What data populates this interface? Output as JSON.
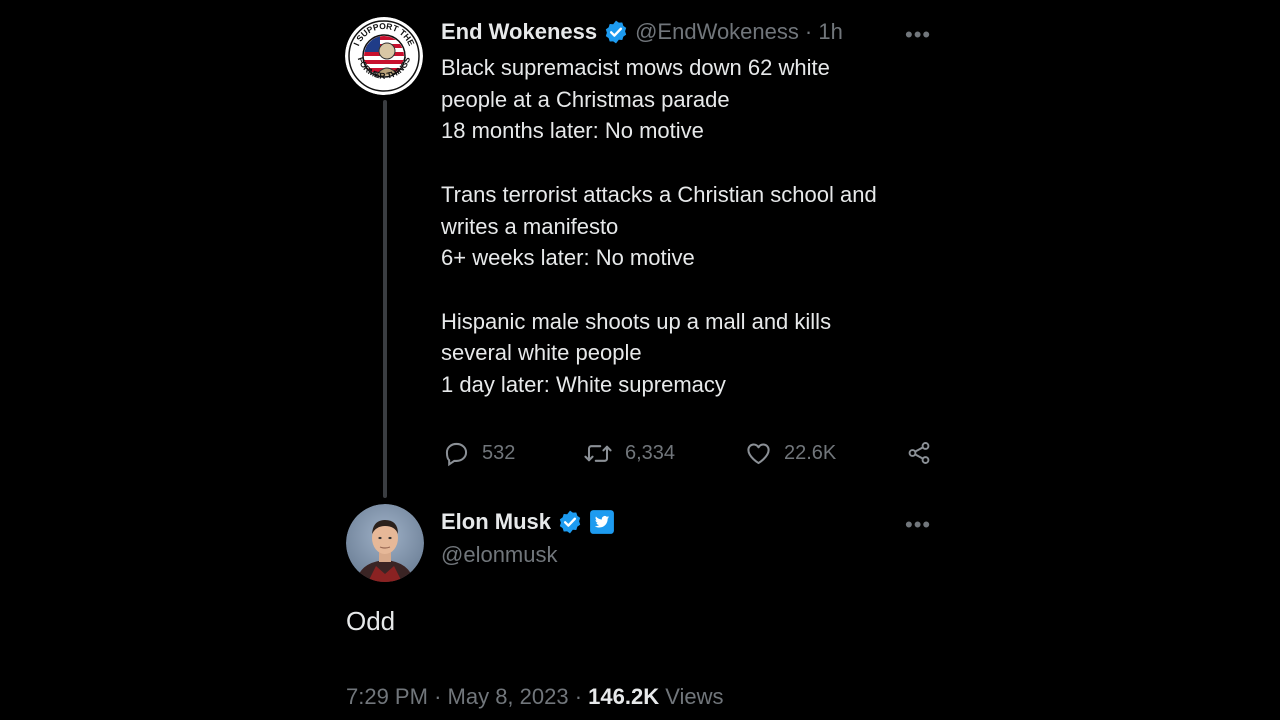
{
  "tweet1": {
    "name": "End Wokeness",
    "handle": "@EndWokeness",
    "time": "· 1h",
    "more_label": "•••",
    "avatar_text_top": "I SUPPORT THE",
    "avatar_text_bottom": "FORMER THINGS",
    "text": "Black supremacist mows down 62 white\npeople at a Christmas parade\n18 months later: No motive\n\nTrans terrorist attacks a Christian school and\nwrites a manifesto\n6+ weeks later: No motive\n\nHispanic male shoots up a mall and kills\nseveral white people\n1 day later: White supremacy",
    "replies": "532",
    "retweets": "6,334",
    "likes": "22.6K",
    "verified_color": "#1d9bf0"
  },
  "tweet2": {
    "name": "Elon Musk",
    "handle": "@elonmusk",
    "more_label": "•••",
    "text": "Odd",
    "time": "7:29 PM",
    "date": "May 8, 2023",
    "views_count": "146.2K",
    "views_label": "Views"
  },
  "icons": {
    "reply": "reply-icon",
    "retweet": "retweet-icon",
    "like": "heart-icon",
    "share": "share-icon",
    "verified": "verified-badge-icon",
    "twitter": "twitter-bird-icon"
  }
}
